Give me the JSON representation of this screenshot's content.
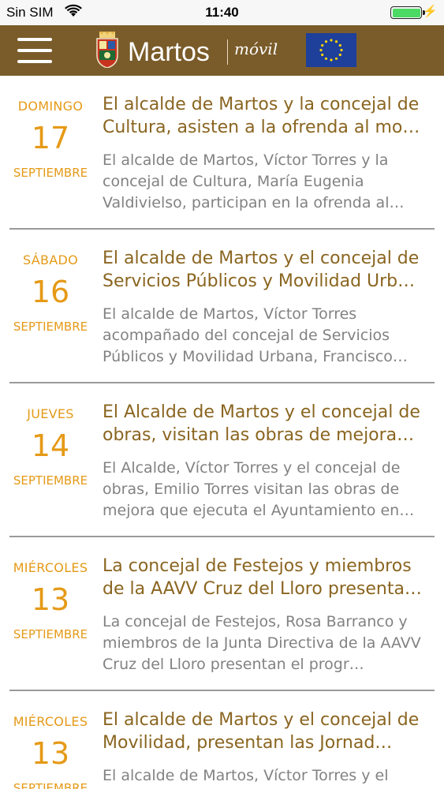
{
  "status_bar": {
    "carrier": "Sin SIM",
    "time": "11:40"
  },
  "header": {
    "app_name": "Martos",
    "app_suffix": "móvil",
    "brand_color": "#7a5c2a",
    "icons": [
      "menu-icon",
      "coat-of-arms-logo",
      "eu-flag"
    ]
  },
  "colors": {
    "date_accent": "#e59a17",
    "title": "#8a6520",
    "summary": "#828282"
  },
  "news": [
    {
      "weekday": "DOMINGO",
      "day": "17",
      "month": "SEPTIEMBRE",
      "title": "El alcalde de Martos y la concejal de Cultura,  asisten a la ofrenda al mo…",
      "summary": "El alcalde de Martos, Víctor Torres y la concejal de Cultura, María Eugenia Valdivielso, participan en la ofrenda al…"
    },
    {
      "weekday": "SÁBADO",
      "day": "16",
      "month": "SEPTIEMBRE",
      "title": "El alcalde de Martos y el concejal de Servicios Públicos y Movilidad Urb…",
      "summary": "El alcalde de Martos, Víctor Torres acompañado del concejal de Servicios Públicos y Movilidad Urbana, Francisco…"
    },
    {
      "weekday": "JUEVES",
      "day": "14",
      "month": "SEPTIEMBRE",
      "title": "El Alcalde de Martos y el concejal de obras, visitan las obras de mejora…",
      "summary": "El Alcalde, Víctor Torres y el concejal de obras, Emilio Torres visitan las obras de mejora que ejecuta el Ayuntamiento en…"
    },
    {
      "weekday": "MIÉRCOLES",
      "day": "13",
      "month": "SEPTIEMBRE",
      "title": "La concejal de Festejos y miembros de la AAVV Cruz del Lloro presenta…",
      "summary": "La concejal de Festejos, Rosa Barranco y miembros de la Junta Directiva de la AAVV Cruz del Lloro presentan el progr…"
    },
    {
      "weekday": "MIÉRCOLES",
      "day": "13",
      "month": "SEPTIEMBRE",
      "title": "El alcalde de Martos  y el concejal de Movilidad, presentan las Jornad…",
      "summary": "El alcalde de Martos, Víctor Torres y el"
    }
  ]
}
